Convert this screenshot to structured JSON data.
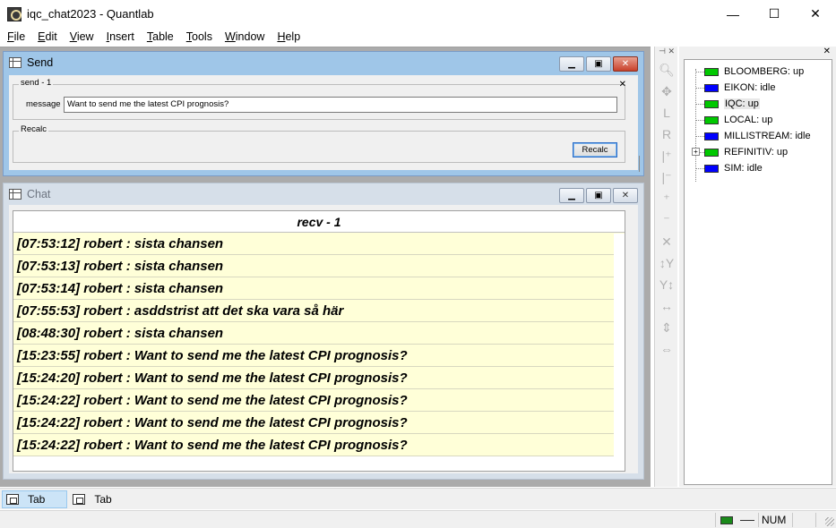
{
  "app": {
    "title": "iqc_chat2023 - Quantlab",
    "controls": {
      "minimize": "—",
      "maximize": "☐",
      "close": "✕"
    }
  },
  "menu": [
    {
      "label": "File",
      "underline": "F",
      "rest": "ile"
    },
    {
      "label": "Edit",
      "underline": "E",
      "rest": "dit"
    },
    {
      "label": "View",
      "underline": "V",
      "rest": "iew"
    },
    {
      "label": "Insert",
      "underline": "I",
      "rest": "nsert"
    },
    {
      "label": "Table",
      "underline": "T",
      "rest": "able"
    },
    {
      "label": "Tools",
      "underline": "T",
      "rest": "ools"
    },
    {
      "label": "Window",
      "underline": "W",
      "rest": "indow"
    },
    {
      "label": "Help",
      "underline": "H",
      "rest": "elp"
    }
  ],
  "send_window": {
    "title": "Send",
    "group1_label": "send - 1",
    "message_label": "message",
    "message_value": "Want to send me the latest CPI prognosis?",
    "group2_label": "Recalc",
    "recalc_button": "Recalc"
  },
  "chat_window": {
    "title": "Chat",
    "column_header": "recv - 1",
    "rows": [
      "[07:53:12] robert : sista chansen",
      "[07:53:13] robert : sista chansen",
      "[07:53:14] robert : sista chansen",
      "[07:55:53] robert : asddstrist att det ska vara så här",
      "[08:48:30] robert : sista chansen",
      "[15:23:55] robert : Want to send me the latest CPI prognosis?",
      "[15:24:20] robert : Want to send me the latest CPI prognosis?",
      "[15:24:22] robert : Want to send me the latest CPI prognosis?",
      "[15:24:22] robert : Want to send me the latest CPI prognosis?",
      "[15:24:22] robert : Want to send me the latest CPI prognosis?"
    ]
  },
  "toolbar_icons": [
    {
      "name": "zoom-icon",
      "glyph": "🔍︎"
    },
    {
      "name": "pan-icon",
      "glyph": "✥"
    },
    {
      "name": "l-icon",
      "glyph": "L"
    },
    {
      "name": "r-icon",
      "glyph": "R"
    },
    {
      "name": "x-plus-icon",
      "glyph": "|⁺"
    },
    {
      "name": "x-minus-icon",
      "glyph": "|⁻"
    },
    {
      "name": "y-plus-icon",
      "glyph": "⁺"
    },
    {
      "name": "y-minus-icon",
      "glyph": "⁻"
    },
    {
      "name": "cross-icon",
      "glyph": "✕"
    },
    {
      "name": "y-expand-icon",
      "glyph": "↕Y"
    },
    {
      "name": "y-compress-icon",
      "glyph": "Y↕"
    },
    {
      "name": "x-arrows-icon",
      "glyph": "↔"
    },
    {
      "name": "y-arrows-icon",
      "glyph": "⇕"
    },
    {
      "name": "xy-arrows-icon",
      "glyph": "⇔"
    }
  ],
  "feeds": [
    {
      "label": "BLOOMBERG: up",
      "color": "#00c800"
    },
    {
      "label": "EIKON: idle",
      "color": "#0000ff"
    },
    {
      "label": "IQC: up",
      "color": "#00c800",
      "selected": true
    },
    {
      "label": "LOCAL: up",
      "color": "#00c800"
    },
    {
      "label": "MILLISTREAM: idle",
      "color": "#0000ff"
    },
    {
      "label": "REFINITIV: up",
      "color": "#00c800",
      "expandable": true
    },
    {
      "label": "SIM: idle",
      "color": "#0000ff"
    }
  ],
  "tabs": [
    {
      "label": "Tab",
      "active": true
    },
    {
      "label": "Tab",
      "active": false
    }
  ],
  "status": {
    "num": "NUM"
  }
}
